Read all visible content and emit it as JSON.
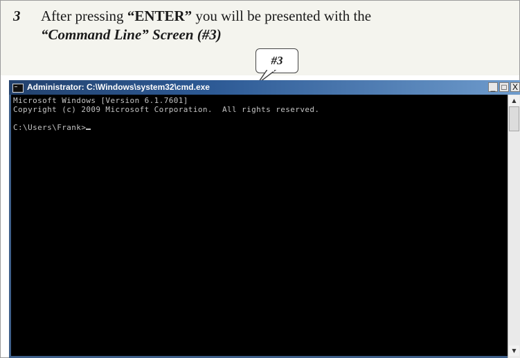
{
  "caption": {
    "step_number": "3",
    "line1_pre": "After pressing ",
    "line1_key": "“ENTER”",
    "line1_post": " you will be presented with the",
    "line2": "“Command Line” Screen (#3)",
    "callout": "#3"
  },
  "window": {
    "title": "Administrator: C:\\Windows\\system32\\cmd.exe",
    "icon": "cmd-window-icon",
    "controls": {
      "minimize": "_",
      "maximize": "□",
      "close": "X"
    }
  },
  "console": {
    "lines": [
      "Microsoft Windows [Version 6.1.7601]",
      "Copyright (c) 2009 Microsoft Corporation.  All rights reserved.",
      "",
      "C:\\Users\\Frank>"
    ],
    "background": "#000000",
    "text_color": "#c4c4c4"
  },
  "scrollbar": {
    "up": "▲",
    "down": "▼"
  },
  "colors": {
    "titlebar_start": "#23426e",
    "titlebar_end": "#6f9ccd",
    "caption_bg": "#f4f4ee"
  }
}
